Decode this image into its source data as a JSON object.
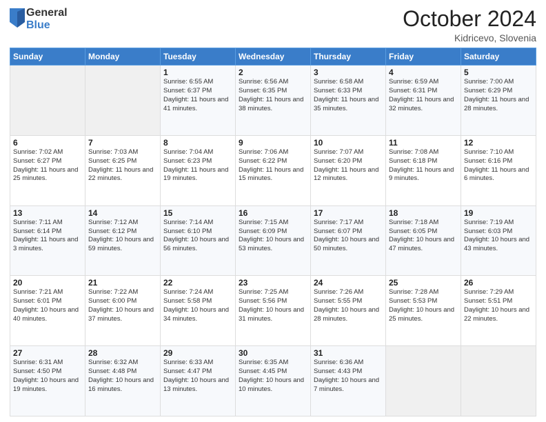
{
  "header": {
    "logo": {
      "general": "General",
      "blue": "Blue"
    },
    "title": "October 2024",
    "subtitle": "Kidricevo, Slovenia"
  },
  "calendar": {
    "days_of_week": [
      "Sunday",
      "Monday",
      "Tuesday",
      "Wednesday",
      "Thursday",
      "Friday",
      "Saturday"
    ],
    "weeks": [
      [
        {
          "day": "",
          "sunrise": "",
          "sunset": "",
          "daylight": "",
          "empty": true
        },
        {
          "day": "",
          "sunrise": "",
          "sunset": "",
          "daylight": "",
          "empty": true
        },
        {
          "day": "1",
          "sunrise": "Sunrise: 6:55 AM",
          "sunset": "Sunset: 6:37 PM",
          "daylight": "Daylight: 11 hours and 41 minutes.",
          "empty": false
        },
        {
          "day": "2",
          "sunrise": "Sunrise: 6:56 AM",
          "sunset": "Sunset: 6:35 PM",
          "daylight": "Daylight: 11 hours and 38 minutes.",
          "empty": false
        },
        {
          "day": "3",
          "sunrise": "Sunrise: 6:58 AM",
          "sunset": "Sunset: 6:33 PM",
          "daylight": "Daylight: 11 hours and 35 minutes.",
          "empty": false
        },
        {
          "day": "4",
          "sunrise": "Sunrise: 6:59 AM",
          "sunset": "Sunset: 6:31 PM",
          "daylight": "Daylight: 11 hours and 32 minutes.",
          "empty": false
        },
        {
          "day": "5",
          "sunrise": "Sunrise: 7:00 AM",
          "sunset": "Sunset: 6:29 PM",
          "daylight": "Daylight: 11 hours and 28 minutes.",
          "empty": false
        }
      ],
      [
        {
          "day": "6",
          "sunrise": "Sunrise: 7:02 AM",
          "sunset": "Sunset: 6:27 PM",
          "daylight": "Daylight: 11 hours and 25 minutes.",
          "empty": false
        },
        {
          "day": "7",
          "sunrise": "Sunrise: 7:03 AM",
          "sunset": "Sunset: 6:25 PM",
          "daylight": "Daylight: 11 hours and 22 minutes.",
          "empty": false
        },
        {
          "day": "8",
          "sunrise": "Sunrise: 7:04 AM",
          "sunset": "Sunset: 6:23 PM",
          "daylight": "Daylight: 11 hours and 19 minutes.",
          "empty": false
        },
        {
          "day": "9",
          "sunrise": "Sunrise: 7:06 AM",
          "sunset": "Sunset: 6:22 PM",
          "daylight": "Daylight: 11 hours and 15 minutes.",
          "empty": false
        },
        {
          "day": "10",
          "sunrise": "Sunrise: 7:07 AM",
          "sunset": "Sunset: 6:20 PM",
          "daylight": "Daylight: 11 hours and 12 minutes.",
          "empty": false
        },
        {
          "day": "11",
          "sunrise": "Sunrise: 7:08 AM",
          "sunset": "Sunset: 6:18 PM",
          "daylight": "Daylight: 11 hours and 9 minutes.",
          "empty": false
        },
        {
          "day": "12",
          "sunrise": "Sunrise: 7:10 AM",
          "sunset": "Sunset: 6:16 PM",
          "daylight": "Daylight: 11 hours and 6 minutes.",
          "empty": false
        }
      ],
      [
        {
          "day": "13",
          "sunrise": "Sunrise: 7:11 AM",
          "sunset": "Sunset: 6:14 PM",
          "daylight": "Daylight: 11 hours and 3 minutes.",
          "empty": false
        },
        {
          "day": "14",
          "sunrise": "Sunrise: 7:12 AM",
          "sunset": "Sunset: 6:12 PM",
          "daylight": "Daylight: 10 hours and 59 minutes.",
          "empty": false
        },
        {
          "day": "15",
          "sunrise": "Sunrise: 7:14 AM",
          "sunset": "Sunset: 6:10 PM",
          "daylight": "Daylight: 10 hours and 56 minutes.",
          "empty": false
        },
        {
          "day": "16",
          "sunrise": "Sunrise: 7:15 AM",
          "sunset": "Sunset: 6:09 PM",
          "daylight": "Daylight: 10 hours and 53 minutes.",
          "empty": false
        },
        {
          "day": "17",
          "sunrise": "Sunrise: 7:17 AM",
          "sunset": "Sunset: 6:07 PM",
          "daylight": "Daylight: 10 hours and 50 minutes.",
          "empty": false
        },
        {
          "day": "18",
          "sunrise": "Sunrise: 7:18 AM",
          "sunset": "Sunset: 6:05 PM",
          "daylight": "Daylight: 10 hours and 47 minutes.",
          "empty": false
        },
        {
          "day": "19",
          "sunrise": "Sunrise: 7:19 AM",
          "sunset": "Sunset: 6:03 PM",
          "daylight": "Daylight: 10 hours and 43 minutes.",
          "empty": false
        }
      ],
      [
        {
          "day": "20",
          "sunrise": "Sunrise: 7:21 AM",
          "sunset": "Sunset: 6:01 PM",
          "daylight": "Daylight: 10 hours and 40 minutes.",
          "empty": false
        },
        {
          "day": "21",
          "sunrise": "Sunrise: 7:22 AM",
          "sunset": "Sunset: 6:00 PM",
          "daylight": "Daylight: 10 hours and 37 minutes.",
          "empty": false
        },
        {
          "day": "22",
          "sunrise": "Sunrise: 7:24 AM",
          "sunset": "Sunset: 5:58 PM",
          "daylight": "Daylight: 10 hours and 34 minutes.",
          "empty": false
        },
        {
          "day": "23",
          "sunrise": "Sunrise: 7:25 AM",
          "sunset": "Sunset: 5:56 PM",
          "daylight": "Daylight: 10 hours and 31 minutes.",
          "empty": false
        },
        {
          "day": "24",
          "sunrise": "Sunrise: 7:26 AM",
          "sunset": "Sunset: 5:55 PM",
          "daylight": "Daylight: 10 hours and 28 minutes.",
          "empty": false
        },
        {
          "day": "25",
          "sunrise": "Sunrise: 7:28 AM",
          "sunset": "Sunset: 5:53 PM",
          "daylight": "Daylight: 10 hours and 25 minutes.",
          "empty": false
        },
        {
          "day": "26",
          "sunrise": "Sunrise: 7:29 AM",
          "sunset": "Sunset: 5:51 PM",
          "daylight": "Daylight: 10 hours and 22 minutes.",
          "empty": false
        }
      ],
      [
        {
          "day": "27",
          "sunrise": "Sunrise: 6:31 AM",
          "sunset": "Sunset: 4:50 PM",
          "daylight": "Daylight: 10 hours and 19 minutes.",
          "empty": false
        },
        {
          "day": "28",
          "sunrise": "Sunrise: 6:32 AM",
          "sunset": "Sunset: 4:48 PM",
          "daylight": "Daylight: 10 hours and 16 minutes.",
          "empty": false
        },
        {
          "day": "29",
          "sunrise": "Sunrise: 6:33 AM",
          "sunset": "Sunset: 4:47 PM",
          "daylight": "Daylight: 10 hours and 13 minutes.",
          "empty": false
        },
        {
          "day": "30",
          "sunrise": "Sunrise: 6:35 AM",
          "sunset": "Sunset: 4:45 PM",
          "daylight": "Daylight: 10 hours and 10 minutes.",
          "empty": false
        },
        {
          "day": "31",
          "sunrise": "Sunrise: 6:36 AM",
          "sunset": "Sunset: 4:43 PM",
          "daylight": "Daylight: 10 hours and 7 minutes.",
          "empty": false
        },
        {
          "day": "",
          "sunrise": "",
          "sunset": "",
          "daylight": "",
          "empty": true
        },
        {
          "day": "",
          "sunrise": "",
          "sunset": "",
          "daylight": "",
          "empty": true
        }
      ]
    ]
  }
}
